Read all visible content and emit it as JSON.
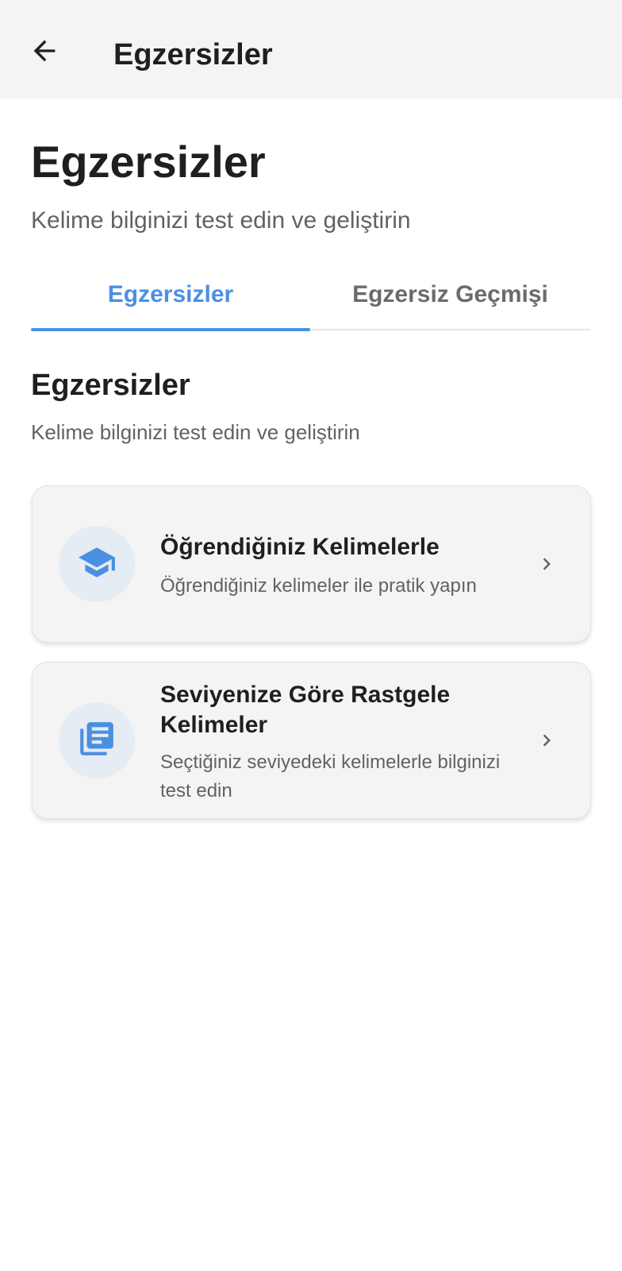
{
  "app_bar": {
    "back_icon": "arrow-back-icon",
    "title": "Egzersizler"
  },
  "header": {
    "title": "Egzersizler",
    "subtitle": "Kelime bilginizi test edin ve geliştirin"
  },
  "tabs": [
    {
      "label": "Egzersizler",
      "active": true
    },
    {
      "label": "Egzersiz Geçmişi",
      "active": false
    }
  ],
  "section": {
    "title": "Egzersizler",
    "subtitle": "Kelime bilginizi test edin ve geliştirin"
  },
  "cards": [
    {
      "icon": "graduation-cap-icon",
      "title": "Öğrendiğiniz Kelimelerle",
      "description": "Öğrendiğiniz kelimeler ile pratik yapın",
      "chevron": "chevron-right-icon"
    },
    {
      "icon": "library-books-icon",
      "title": "Seviyenize Göre Rastgele Kelimeler",
      "description": "Seçtiğiniz seviyedeki kelimelerle bilginizi test edin",
      "chevron": "chevron-right-icon"
    }
  ],
  "colors": {
    "accent": "#4a90e2",
    "app_bar_bg": "#f4f4f4",
    "card_bg": "#f4f4f4",
    "icon_circle_bg": "#e6ecf4",
    "text_primary": "#1f1f1f",
    "text_secondary": "#5f6368",
    "tab_inactive": "#6b6b6b"
  }
}
